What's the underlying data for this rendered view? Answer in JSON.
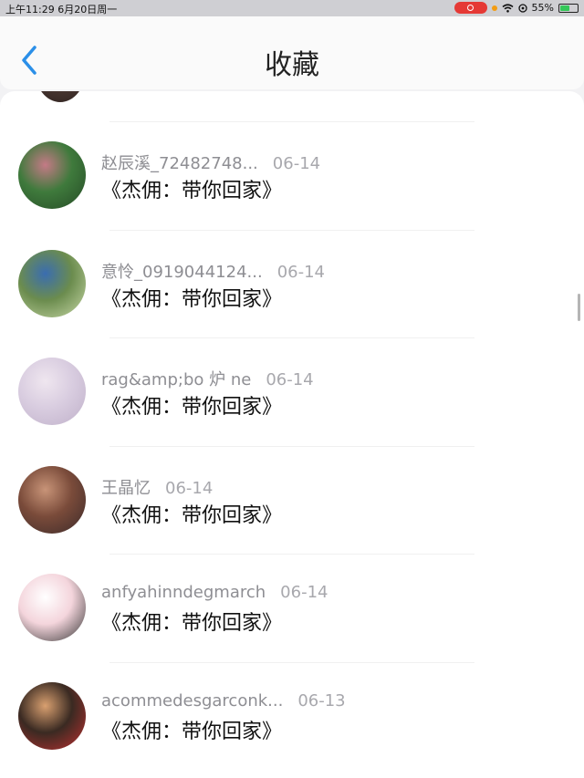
{
  "status_bar": {
    "time_date": "上午11:29  6月20日周一",
    "battery": "55%",
    "battery_level": 0.55
  },
  "header": {
    "title": "收藏",
    "back_icon": "chevron-left-icon"
  },
  "favorites": [
    {
      "user": "赵辰溪_72482748...",
      "date": "06-14",
      "content": "《杰佣：带你回家》",
      "avatar_colors": [
        "#3f7a3c",
        "#c47a86",
        "#254a26"
      ]
    },
    {
      "user": "意怜_0919044124...",
      "date": "06-14",
      "content": "《杰佣：带你回家》",
      "avatar_colors": [
        "#6b8c4e",
        "#3a6db0",
        "#c9d9a8"
      ]
    },
    {
      "user": "rag&amp;bo 炉 ne",
      "date": "06-14",
      "content": "《杰佣：带你回家》",
      "avatar_colors": [
        "#d9cde0",
        "#efe6ef",
        "#bfb0c9"
      ]
    },
    {
      "user": "王晶忆",
      "date": "06-14",
      "content": "《杰佣：带你回家》",
      "avatar_colors": [
        "#7a4b3a",
        "#c89478",
        "#3b2a2a"
      ]
    },
    {
      "user": "anfyahinndegmarch",
      "date": "06-14",
      "content": "《杰佣：带你回家》",
      "avatar_colors": [
        "#f4d5dc",
        "#ffffff",
        "#333333"
      ]
    },
    {
      "user": "acommedesgarconk...",
      "date": "06-13",
      "content": "《杰佣：带你回家》",
      "avatar_colors": [
        "#3a2a22",
        "#d9a070",
        "#c03030"
      ]
    }
  ]
}
